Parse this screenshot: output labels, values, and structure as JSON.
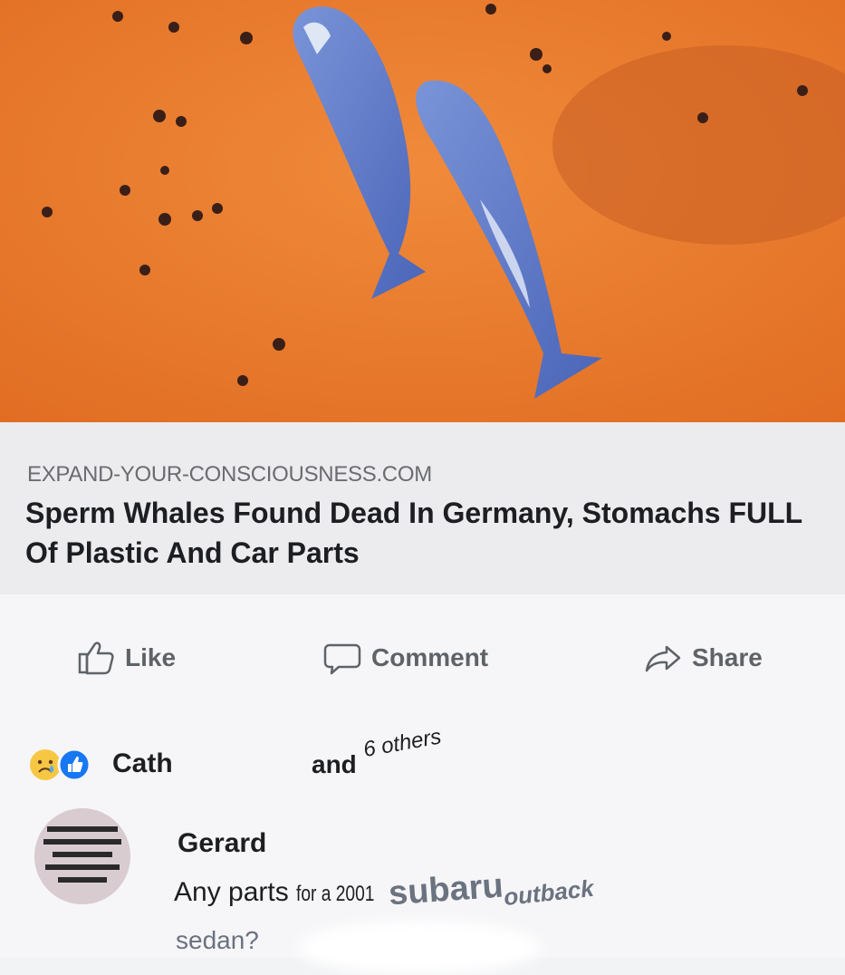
{
  "post": {
    "image_alt": "aerial view of two stranded sperm whales on a beach",
    "link": {
      "domain": "EXPAND-YOUR-CONSCIOUSNESS.COM",
      "title": "Sperm Whales Found Dead In Germany, Stomachs FULL Of Plastic And Car Parts"
    },
    "actions": {
      "like": "Like",
      "comment": "Comment",
      "share": "Share"
    },
    "reactions": {
      "name": "Cath",
      "and_text": "and",
      "others_text": "6 others",
      "icons": [
        "sad-emoji-icon",
        "like-reaction-icon"
      ]
    },
    "comment": {
      "author": "Gerard",
      "text_parts": [
        "Any parts ",
        "for a 2001 ",
        "subaru ",
        "outback"
      ],
      "text_line2": "sedan?"
    }
  },
  "colors": {
    "sand": "#e8742a",
    "whale": "#5a78c8",
    "text_primary": "#1c1e21",
    "text_secondary": "#5f6368",
    "like_blue": "#1877f2"
  }
}
